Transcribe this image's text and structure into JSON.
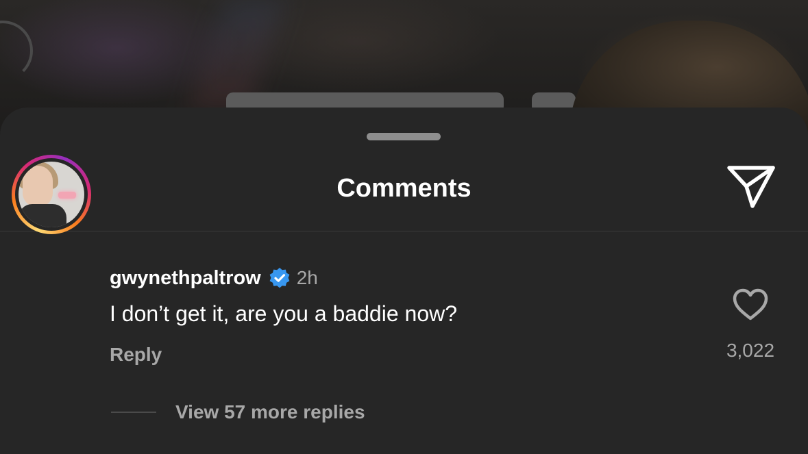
{
  "sheet": {
    "title": "Comments",
    "share_icon": "paper-plane-icon"
  },
  "comment": {
    "username": "gwynethpaltrow",
    "verified_icon": "verified-badge-icon",
    "timestamp": "2h",
    "text": "I don’t get it, are you a baddie now?",
    "reply_label": "Reply",
    "like_icon": "heart-icon",
    "like_count": "3,022",
    "view_replies_label": "View 57 more replies"
  },
  "colors": {
    "sheet_background": "#262626",
    "verified_blue": "#3897f0",
    "secondary_text": "#a8a8a8"
  }
}
